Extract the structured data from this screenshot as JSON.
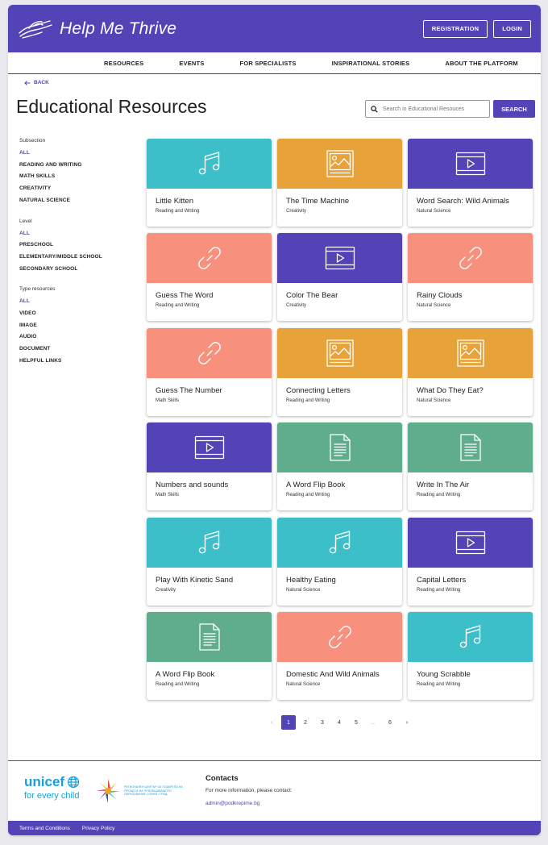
{
  "header": {
    "logo_text": "Help Me Thrive",
    "registration_label": "REGISTRATION",
    "login_label": "LOGIN"
  },
  "nav": {
    "items": [
      "RESOURCES",
      "EVENTS",
      "FOR SPECIALISTS",
      "INSPIRATIONAL STORIES",
      "ABOUT THE PLATFORM"
    ]
  },
  "back_label": "BACK",
  "page_title": "Educational Resources",
  "search": {
    "placeholder": "Search in Educational Resouces",
    "button_label": "SEARCH"
  },
  "filters": [
    {
      "title": "Subsection",
      "options": [
        "ALL",
        "READING AND WRITING",
        "MATH SKILLS",
        "CREATIVITY",
        "NATURAL SCIENCE"
      ],
      "active": 0
    },
    {
      "title": "Level",
      "options": [
        "ALL",
        "PRESCHOOL",
        "ELEMENTARY/MIDDLE SCHOOL",
        "SECONDARY SCHOOL"
      ],
      "active": 0
    },
    {
      "title": "Type resources",
      "options": [
        "ALL",
        "VIDEO",
        "IMAGE",
        "AUDIO",
        "DOCUMENT",
        "HELPFUL LINKS"
      ],
      "active": 0
    }
  ],
  "colors": {
    "brand": "#5243b7",
    "teal": "#3cbfc8",
    "orange": "#e8a23a",
    "purple": "#5243b7",
    "salmon": "#f7917e",
    "green": "#5fad8c"
  },
  "resources": [
    {
      "title": "Little Kitten",
      "category": "Reading and Writing",
      "icon": "music-note-icon",
      "color": "#3cbfc8"
    },
    {
      "title": "The Time Machine",
      "category": "Creativity",
      "icon": "image-icon",
      "color": "#e8a23a"
    },
    {
      "title": "Word Search: Wild Animals",
      "category": "Natural Science",
      "icon": "video-icon",
      "color": "#5243b7"
    },
    {
      "title": "Guess The Word",
      "category": "Reading and Writing",
      "icon": "link-icon",
      "color": "#f7917e"
    },
    {
      "title": "Color The Bear",
      "category": "Creativity",
      "icon": "video-icon",
      "color": "#5243b7"
    },
    {
      "title": "Rainy Clouds",
      "category": "Natural Science",
      "icon": "link-icon",
      "color": "#f7917e"
    },
    {
      "title": "Guess The Number",
      "category": "Math Skills",
      "icon": "link-icon",
      "color": "#f7917e"
    },
    {
      "title": "Connecting Letters",
      "category": "Reading and Writing",
      "icon": "image-icon",
      "color": "#e8a23a"
    },
    {
      "title": "What Do They Eat?",
      "category": "Natural Science",
      "icon": "image-icon",
      "color": "#e8a23a"
    },
    {
      "title": "Numbers and sounds",
      "category": "Math Skills",
      "icon": "video-icon",
      "color": "#5243b7"
    },
    {
      "title": "A Word Flip Book",
      "category": "Reading and Writing",
      "icon": "document-icon",
      "color": "#5fad8c"
    },
    {
      "title": "Write In The Air",
      "category": "Reading and Writing",
      "icon": "document-icon",
      "color": "#5fad8c"
    },
    {
      "title": "Play With Kinetic Sand",
      "category": "Creativity",
      "icon": "music-note-icon",
      "color": "#3cbfc8"
    },
    {
      "title": "Healthy Eating",
      "category": "Natural Science",
      "icon": "music-note-icon",
      "color": "#3cbfc8"
    },
    {
      "title": "Capital Letters",
      "category": "Reading and Writing",
      "icon": "video-icon",
      "color": "#5243b7"
    },
    {
      "title": "A Word Flip Book",
      "category": "Reading and Writing",
      "icon": "document-icon",
      "color": "#5fad8c"
    },
    {
      "title": "Domestic And Wild Animals",
      "category": "Natural Science",
      "icon": "link-icon",
      "color": "#f7917e"
    },
    {
      "title": "Young Scrabble",
      "category": "Reading and Writing",
      "icon": "music-note-icon",
      "color": "#3cbfc8"
    }
  ],
  "pagination": {
    "prev": "‹",
    "pages": [
      "1",
      "2",
      "3",
      "4",
      "5",
      "...",
      "6"
    ],
    "next": "›",
    "current": 0
  },
  "footer": {
    "unicef_name": "unicef",
    "unicef_tagline": "for every child",
    "partner_text": "РЕГИОНАЛЕН ЦЕНТЪР ЗА ПОДКРЕПА НА ПРОЦЕСА НА ПРИОБЩАВАЩОТО ОБРАЗОВАНИЕ СОФИЯ - ГРАД",
    "contacts_title": "Contacts",
    "contacts_line": "For more information, please contact:",
    "contacts_email": "admin@podkrepime.bg",
    "links": [
      "Terms and Conditions",
      "Privacy Policy"
    ]
  }
}
